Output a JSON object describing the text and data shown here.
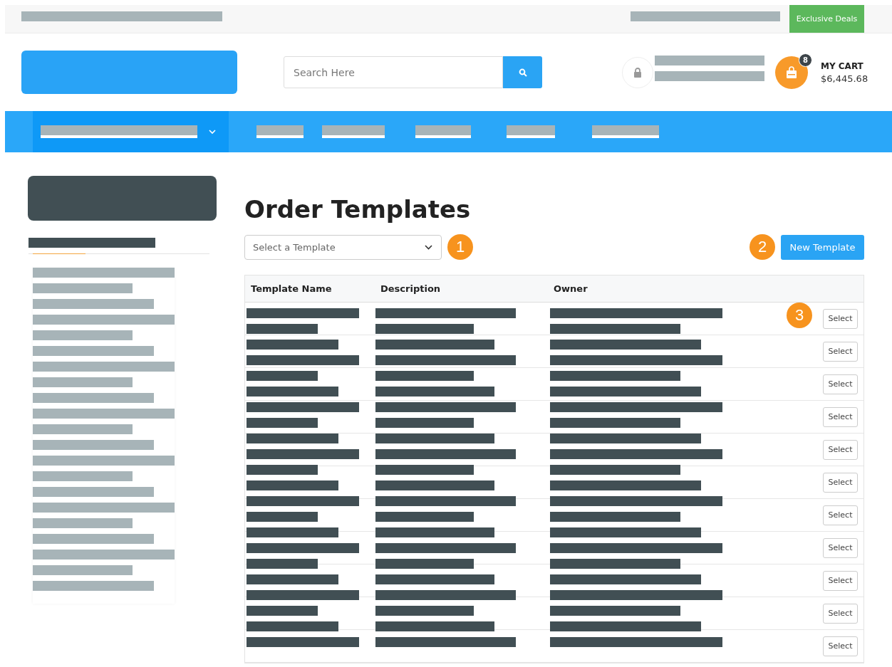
{
  "top_bar": {
    "deals_link": "Exclusive Deals"
  },
  "header": {
    "search": {
      "placeholder": "Search Here"
    },
    "cart": {
      "badge": "8",
      "label": "MY CART",
      "total": "$6,445.68"
    }
  },
  "page": {
    "title": "Order Templates",
    "template_select": {
      "placeholder": "Select a Template"
    },
    "new_template_button": "New Template",
    "callouts": [
      "1",
      "2",
      "3"
    ]
  },
  "table": {
    "columns": [
      "Template Name",
      "Description",
      "Owner"
    ],
    "rows": [
      {
        "action": "Select"
      },
      {
        "action": "Select"
      },
      {
        "action": "Select"
      },
      {
        "action": "Select"
      },
      {
        "action": "Select"
      },
      {
        "action": "Select"
      },
      {
        "action": "Select"
      },
      {
        "action": "Select"
      },
      {
        "action": "Select"
      },
      {
        "action": "Select"
      },
      {
        "action": "Select"
      }
    ]
  }
}
